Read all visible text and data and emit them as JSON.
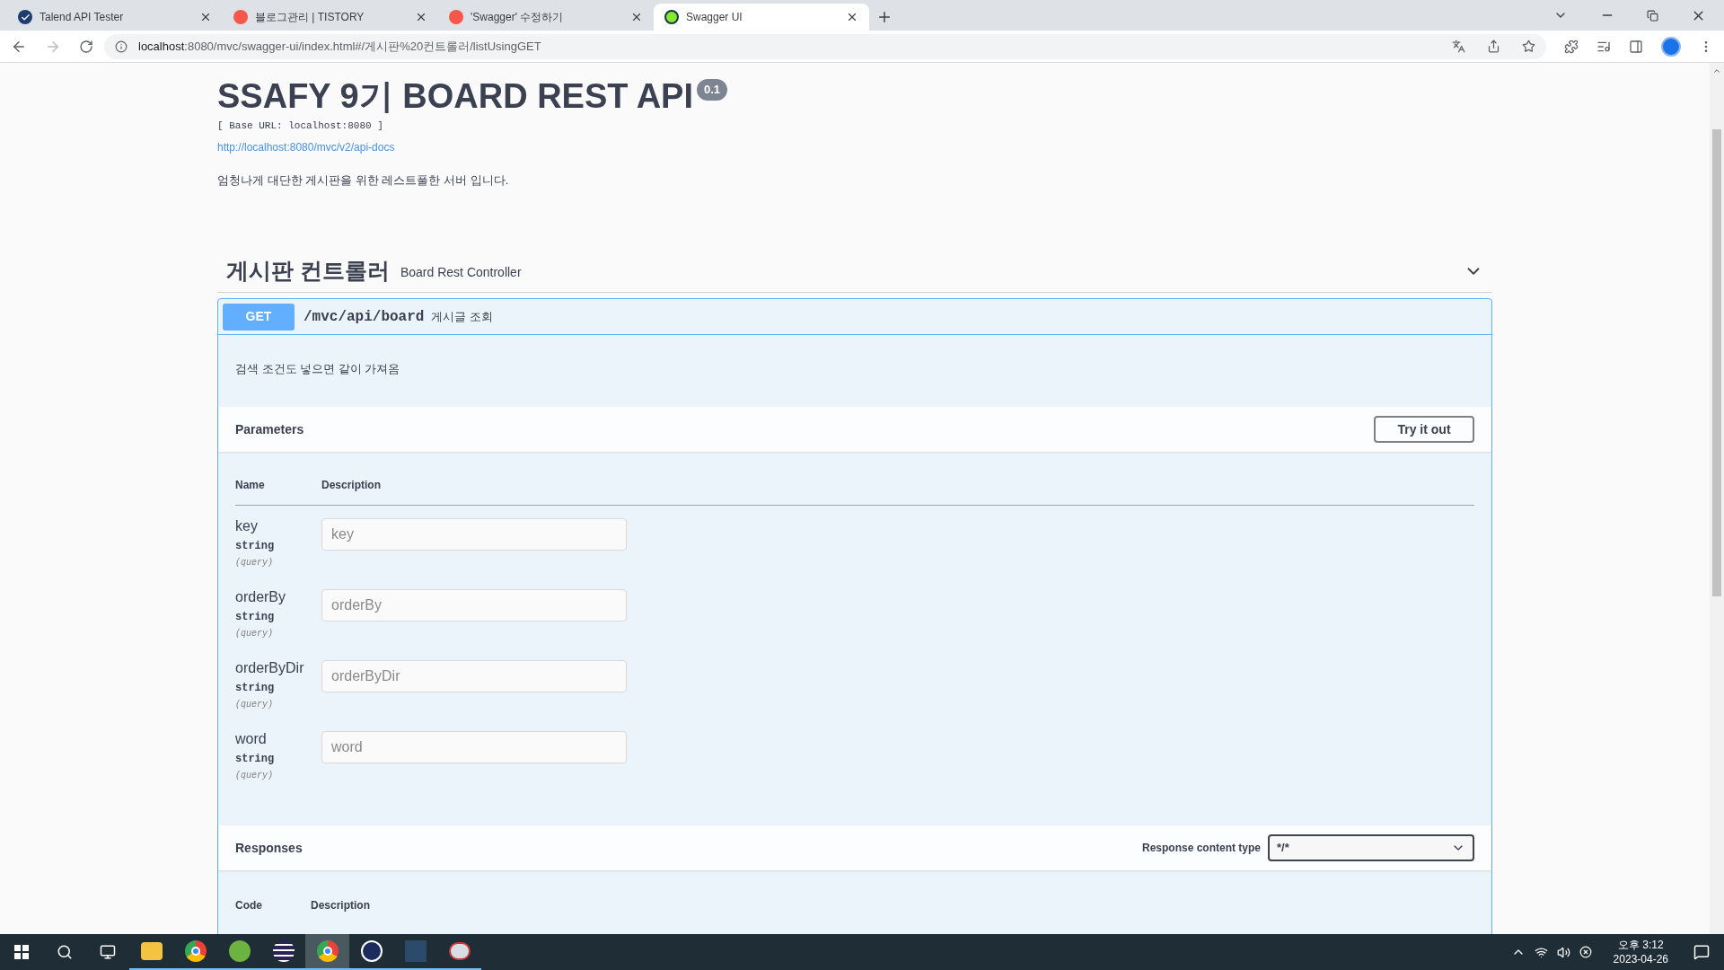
{
  "tabs": [
    {
      "kind": "check",
      "title": "Talend API Tester",
      "selected": false
    },
    {
      "kind": "tistory",
      "title": "블로그관리 | TISTORY",
      "selected": false
    },
    {
      "kind": "tistory",
      "title": "'Swagger' 수정하기",
      "selected": false
    },
    {
      "kind": "swagger",
      "title": "Swagger UI",
      "selected": true
    }
  ],
  "address": {
    "host": "localhost",
    "rest": ":8080/mvc/swagger-ui/index.html#/게시판%20컨트롤러/listUsingGET"
  },
  "info": {
    "title": "SSAFY 9기 BOARD REST API",
    "version": "0.1",
    "base_url": "[ Base URL: localhost:8080 ]",
    "docs_link": "http://localhost:8080/mvc/v2/api-docs",
    "description": "엄청나게 대단한 게시판을 위한 레스트풀한 서버 입니다."
  },
  "tag": {
    "name": "게시판 컨트롤러",
    "description": "Board Rest Controller",
    "expanded": true
  },
  "operation": {
    "method": "GET",
    "path": "/mvc/api/board",
    "summary": "게시글 조회",
    "description": "검색 조건도 넣으면 같이 가져옴",
    "parameters_title": "Parameters",
    "try_button": "Try it out",
    "columns": [
      "Name",
      "Description"
    ],
    "parameters": [
      {
        "name": "key",
        "type": "string",
        "in": "(query)",
        "placeholder": "key"
      },
      {
        "name": "orderBy",
        "type": "string",
        "in": "(query)",
        "placeholder": "orderBy"
      },
      {
        "name": "orderByDir",
        "type": "string",
        "in": "(query)",
        "placeholder": "orderByDir"
      },
      {
        "name": "word",
        "type": "string",
        "in": "(query)",
        "placeholder": "word"
      }
    ],
    "responses_title": "Responses",
    "content_type_label": "Response content type",
    "content_type": "*/*",
    "response_columns": [
      "Code",
      "Description"
    ]
  },
  "taskbar": {
    "apps": [
      {
        "kind": "folder",
        "selected": false
      },
      {
        "kind": "chrome",
        "selected": false
      },
      {
        "kind": "leaf",
        "selected": false
      },
      {
        "kind": "eclipse",
        "selected": false
      },
      {
        "kind": "chrome",
        "selected": true
      },
      {
        "kind": "power",
        "selected": false
      },
      {
        "kind": "db",
        "selected": false
      },
      {
        "kind": "fish",
        "selected": false
      }
    ],
    "time": "오후 3:12",
    "date": "2023-04-26"
  }
}
